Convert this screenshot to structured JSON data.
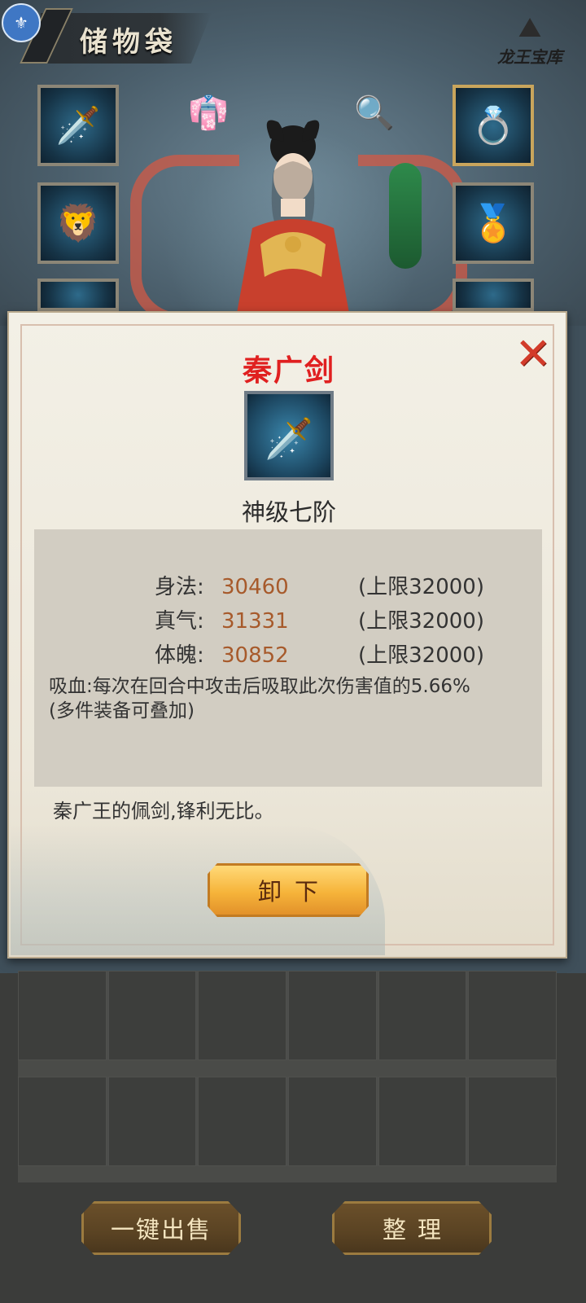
{
  "header": {
    "title": "储物袋",
    "vault_label": "龙王宝库"
  },
  "equipment": {
    "left_slots": [
      "sword-icon",
      "helmet-icon",
      "armor-icon"
    ],
    "right_slots": [
      "ring-icon",
      "amulet-icon",
      "bead-icon"
    ],
    "center_icons": [
      "outfit-icon",
      "zoom-in-icon"
    ]
  },
  "popup": {
    "item_name": "秦广剑",
    "item_grade": "神级七阶",
    "stats": [
      {
        "label": "身法:",
        "value": "30460",
        "cap": "(上限32000)"
      },
      {
        "label": "真气:",
        "value": "31331",
        "cap": "(上限32000)"
      },
      {
        "label": "体魄:",
        "value": "30852",
        "cap": "(上限32000)"
      }
    ],
    "lifesteal": "吸血:每次在回合中攻击后吸取此次伤害值的5.66%",
    "lifesteal_note": "(多件装备可叠加)",
    "description": "秦广王的佩剑,锋利无比。",
    "unequip_label": "卸下"
  },
  "bottom": {
    "sell_all_label": "一键出售",
    "sort_label": "整理"
  },
  "colors": {
    "item_name": "#e02020",
    "stat_value": "#a75a2b",
    "gold_button": "#f6b43a",
    "brown_button": "#5a4323"
  }
}
